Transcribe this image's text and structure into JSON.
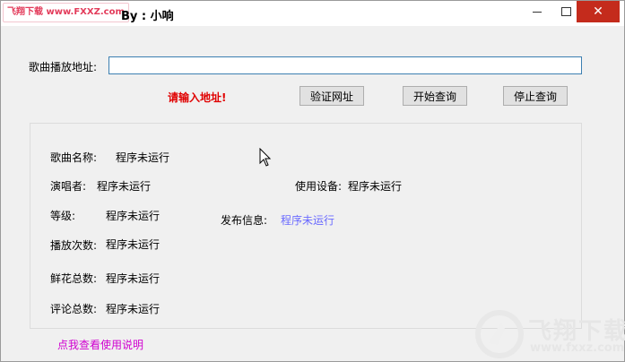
{
  "titlebar": {
    "badge_text": "飞翔下载 www.FXXZ.com",
    "author": "By : 小响",
    "minimize": "—",
    "maximize": "☐",
    "close": "✕"
  },
  "url_section": {
    "label": "歌曲播放地址:",
    "value": "",
    "warning": "请输入地址!",
    "buttons": {
      "verify": "验证网址",
      "start": "开始查询",
      "stop": "停止查询"
    }
  },
  "info": {
    "song_name_label": "歌曲名称:",
    "song_name_value": "程序未运行",
    "singer_label": "演唱者:",
    "singer_value": "程序未运行",
    "device_label": "使用设备:",
    "device_value": "程序未运行",
    "level_label": "等级:",
    "level_value": "程序未运行",
    "publish_label": "发布信息:",
    "publish_value": "程序未运行",
    "plays_label": "播放次数:",
    "plays_value": "程序未运行",
    "flowers_label": "鲜花总数:",
    "flowers_value": "程序未运行",
    "comments_label": "评论总数:",
    "comments_value": "程序未运行"
  },
  "help_link": "点我查看使用说明",
  "watermark": {
    "brand": "飞翔下载",
    "url": "www.fxxz.com"
  }
}
